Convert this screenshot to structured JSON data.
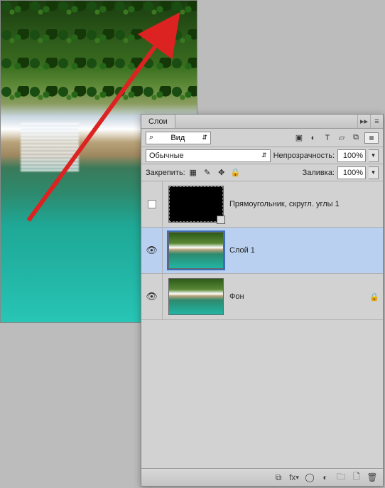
{
  "panel": {
    "tab_title": "Слои",
    "filter": {
      "label": "Вид"
    },
    "blend_mode": "Обычные",
    "opacity": {
      "label": "Непрозрачность:",
      "value": "100%"
    },
    "lock_label": "Закрепить:",
    "fill": {
      "label": "Заливка:",
      "value": "100%"
    }
  },
  "layers": [
    {
      "name": "Прямоугольник, скругл. углы 1",
      "visible": false,
      "locked": false,
      "selected": false,
      "thumb": "shape"
    },
    {
      "name": "Слой 1",
      "visible": true,
      "locked": false,
      "selected": true,
      "thumb": "image"
    },
    {
      "name": "Фон",
      "visible": true,
      "locked": true,
      "selected": false,
      "thumb": "image"
    }
  ],
  "icons": {
    "search": "⌕",
    "image_filter": "▣",
    "adjust_filter": "◐",
    "type_filter": "T",
    "shape_filter": "▱",
    "smart_filter": "⧉",
    "updown": "⇵",
    "lock_trans": "▦",
    "lock_paint": "✎",
    "lock_move": "✥",
    "lock_all": "🔒",
    "eye": "👁",
    "link": "⧉",
    "fx": "fx",
    "mask": "◯",
    "adjustment": "◐",
    "group": "🗀",
    "new_layer": "🗋",
    "trash": "🗑",
    "menu": "≡",
    "collapse": "▸▸"
  }
}
